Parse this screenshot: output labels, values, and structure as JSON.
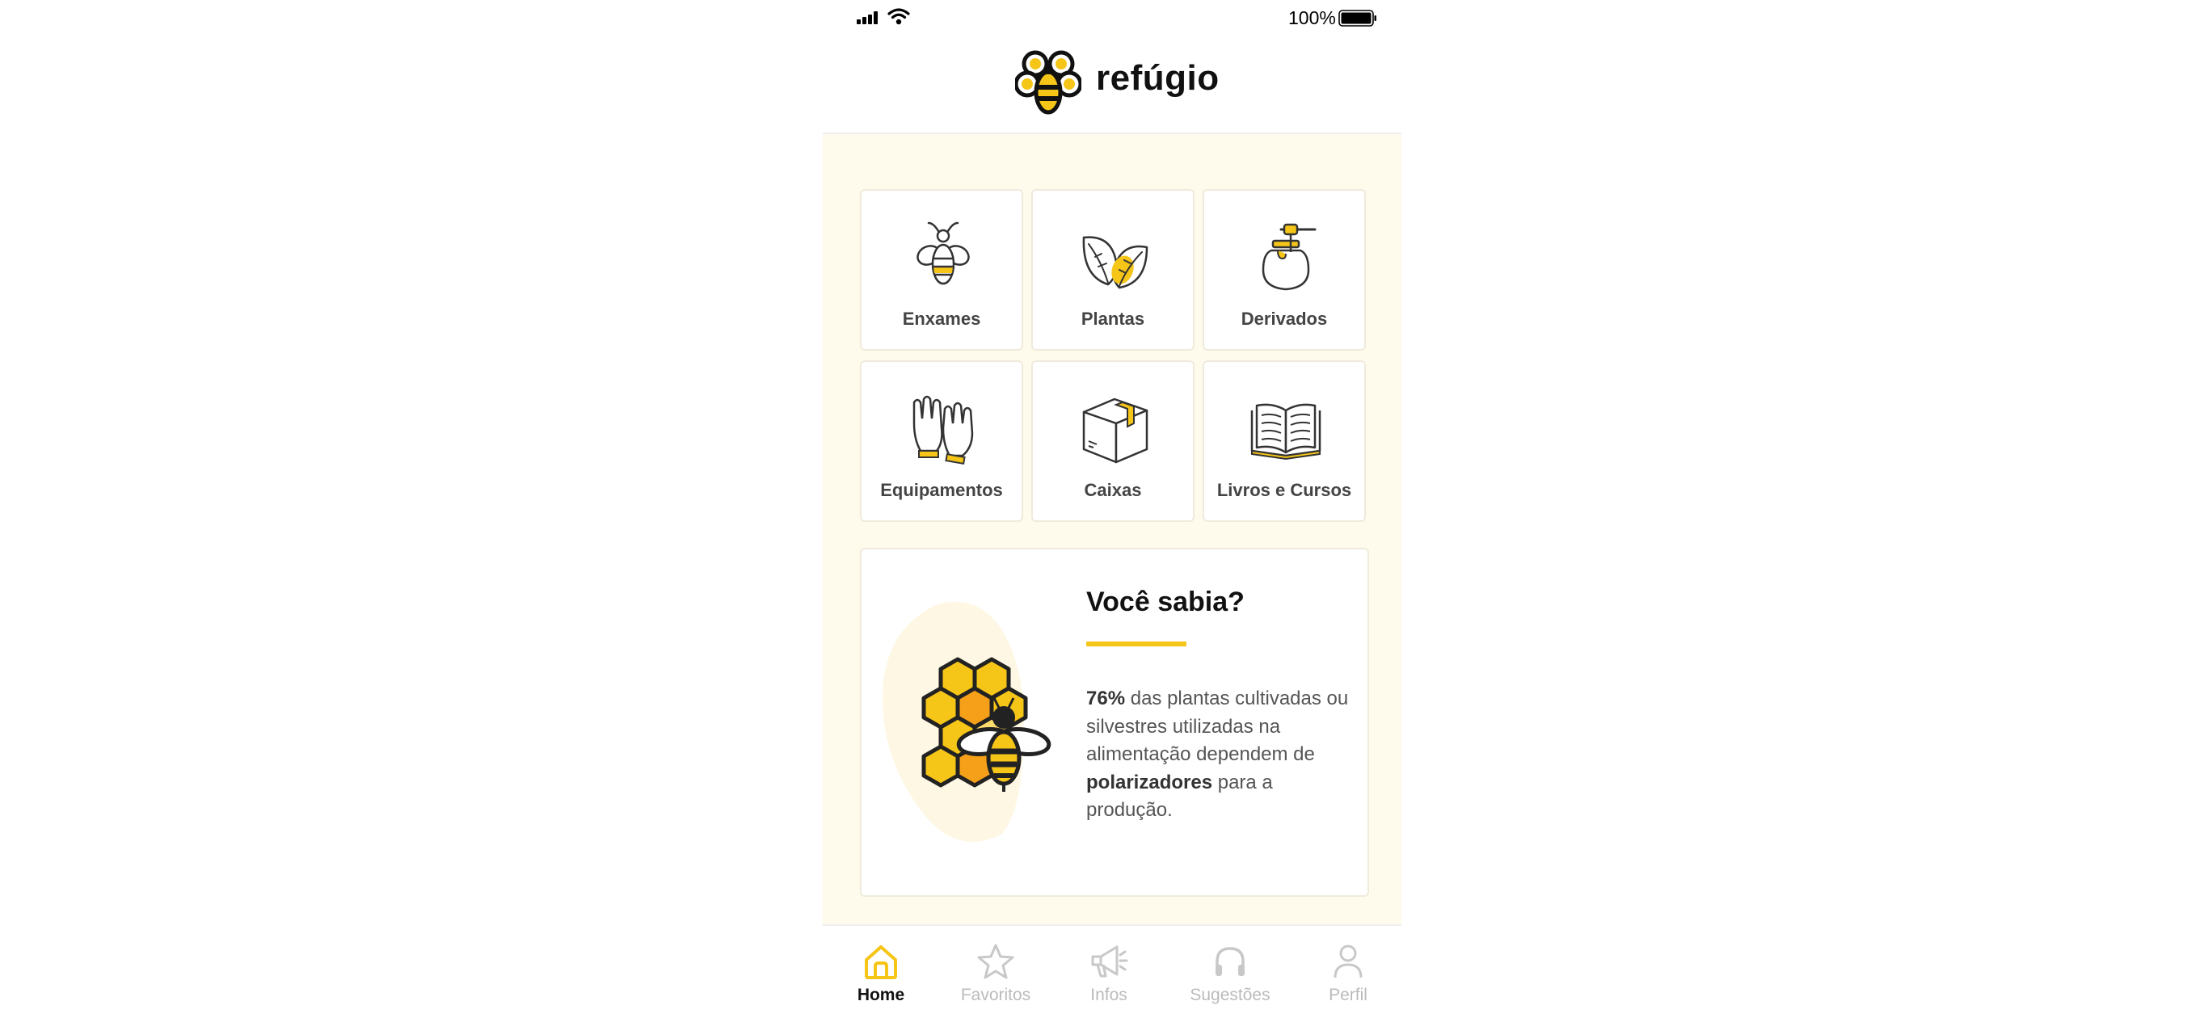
{
  "status_bar": {
    "battery_text": "100%",
    "icons": [
      "signal-icon",
      "wifi-icon",
      "battery-icon"
    ]
  },
  "header": {
    "app_name": "refúgio",
    "logo_icon": "bee-flower-logo-icon"
  },
  "categories": [
    {
      "label": "Enxames",
      "icon": "bee-icon"
    },
    {
      "label": "Plantas",
      "icon": "leaves-icon"
    },
    {
      "label": "Derivados",
      "icon": "honey-jar-icon"
    },
    {
      "label": "Equipamentos",
      "icon": "gloves-icon"
    },
    {
      "label": "Caixas",
      "icon": "box-icon"
    },
    {
      "label": "Livros e Cursos",
      "icon": "open-book-icon"
    }
  ],
  "fact": {
    "title": "Você sabia?",
    "stat": "76%",
    "text_part1": " das plantas cultivadas ou silvestres utilizadas na alimentação dependem de ",
    "highlight": "polarizadores",
    "text_part2": " para a produção.",
    "illustration": "honeycomb-bee-illustration"
  },
  "tabs": [
    {
      "label": "Home",
      "icon": "home-icon",
      "active": true
    },
    {
      "label": "Favoritos",
      "icon": "star-icon",
      "active": false
    },
    {
      "label": "Infos",
      "icon": "megaphone-icon",
      "active": false
    },
    {
      "label": "Sugestões",
      "icon": "headphones-icon",
      "active": false
    },
    {
      "label": "Perfil",
      "icon": "user-icon",
      "active": false
    }
  ],
  "colors": {
    "accent_yellow": "#f5c518",
    "accent_orange": "#f6a01a",
    "content_background": "#fffbec",
    "card_border": "#efeadb",
    "inactive_tab": "#bbbbbb"
  }
}
